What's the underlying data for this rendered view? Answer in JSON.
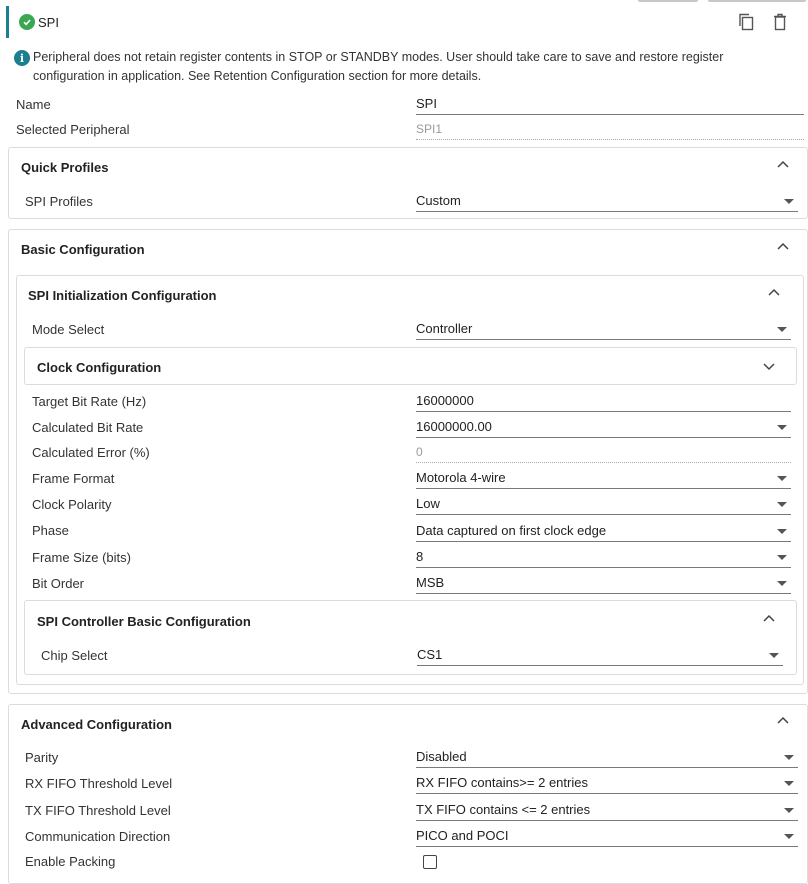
{
  "header": {
    "title": "SPI",
    "icons": [
      "check-circle-icon",
      "copy-icon",
      "delete-icon"
    ]
  },
  "info": {
    "text": "Peripheral does not retain register contents in STOP or STANDBY modes. User should take care to save and restore register configuration in application. See Retention Configuration section for more details."
  },
  "top_fields": {
    "name_label": "Name",
    "name_value": "SPI",
    "peripheral_label": "Selected Peripheral",
    "peripheral_value": "SPI1"
  },
  "quick_profiles": {
    "title": "Quick Profiles",
    "profiles_label": "SPI Profiles",
    "profiles_value": "Custom"
  },
  "basic": {
    "title": "Basic Configuration",
    "init": {
      "title": "SPI Initialization Configuration",
      "mode_label": "Mode Select",
      "mode_value": "Controller",
      "clock": {
        "title": "Clock Configuration"
      },
      "target_label": "Target Bit Rate (Hz)",
      "target_value": "16000000",
      "calc_label": "Calculated Bit Rate",
      "calc_value": "16000000.00",
      "error_label": "Calculated Error (%)",
      "error_value": "0",
      "frame_format_label": "Frame Format",
      "frame_format_value": "Motorola 4-wire",
      "polarity_label": "Clock Polarity",
      "polarity_value": "Low",
      "phase_label": "Phase",
      "phase_value": "Data captured on first clock edge",
      "frame_size_label": "Frame Size (bits)",
      "frame_size_value": "8",
      "bit_order_label": "Bit Order",
      "bit_order_value": "MSB"
    },
    "controller": {
      "title": "SPI Controller Basic Configuration",
      "cs_label": "Chip Select",
      "cs_value": "CS1"
    }
  },
  "advanced": {
    "title": "Advanced Configuration",
    "parity_label": "Parity",
    "parity_value": "Disabled",
    "rx_label": "RX FIFO Threshold Level",
    "rx_value": "RX FIFO contains>= 2 entries",
    "tx_label": "TX FIFO Threshold Level",
    "tx_value": "TX FIFO contains <= 2 entries",
    "dir_label": "Communication Direction",
    "dir_value": "PICO and POCI",
    "packing_label": "Enable Packing",
    "packing_checked": false
  }
}
